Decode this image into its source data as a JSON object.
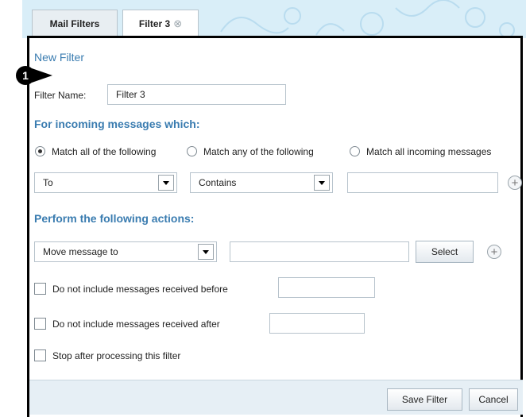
{
  "tabs": [
    {
      "label": "Mail Filters"
    },
    {
      "label": "Filter 3",
      "close_icon": "⊗"
    }
  ],
  "callout": {
    "number": "1"
  },
  "form": {
    "title": "New Filter",
    "filter_name_label": "Filter Name:",
    "filter_name_value": "Filter 3",
    "incoming_heading": "For incoming messages which:",
    "match_options": [
      {
        "label": "Match all of the following",
        "checked": true
      },
      {
        "label": "Match any of the following",
        "checked": false
      },
      {
        "label": "Match all incoming messages",
        "checked": false
      }
    ],
    "condition": {
      "field": "To",
      "operator": "Contains",
      "value": ""
    },
    "actions_heading": "Perform the following actions:",
    "action": {
      "type": "Move message to",
      "folder": "",
      "select_label": "Select"
    },
    "options": [
      {
        "label": "Do not include messages received before",
        "checked": false,
        "date": ""
      },
      {
        "label": "Do not include messages received after",
        "checked": false,
        "date": ""
      },
      {
        "label": "Stop after processing this filter",
        "checked": false
      }
    ]
  },
  "footer": {
    "save_label": "Save Filter",
    "cancel_label": "Cancel"
  },
  "icons": {
    "add": "plus-circle-icon",
    "dropdown": "chevron-down-icon",
    "close": "close-circle-icon"
  }
}
